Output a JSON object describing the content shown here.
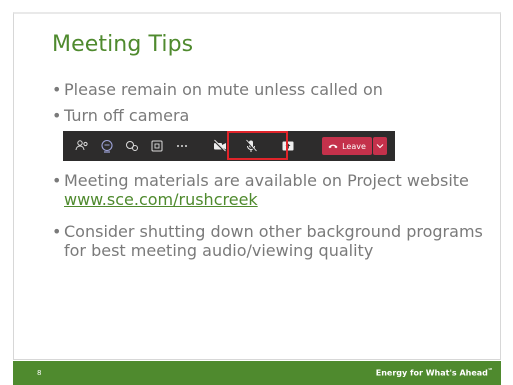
{
  "slide": {
    "title": "Meeting Tips",
    "bullets": [
      {
        "text": "Please remain on mute unless called on"
      },
      {
        "text": "Turn off camera"
      },
      {
        "text_before": "Meeting materials are available on Project website ",
        "link": "www.sce.com/rushcreek"
      },
      {
        "text": "Consider shutting down other background programs for best meeting audio/viewing quality"
      }
    ],
    "bullet_char": "•"
  },
  "toolbar": {
    "icons": [
      "participants-icon",
      "chat-icon",
      "reactions-icon",
      "rooms-icon",
      "more-icon",
      "camera-off-icon",
      "mic-off-icon",
      "share-icon"
    ],
    "leave_label": "Leave",
    "leave_color": "#c4314b",
    "highlight_color": "#e0242a"
  },
  "footer": {
    "page_number": "8",
    "tagline": "Energy for What's Ahead",
    "tagline_mark": "℠",
    "color": "#4f8a2e"
  }
}
